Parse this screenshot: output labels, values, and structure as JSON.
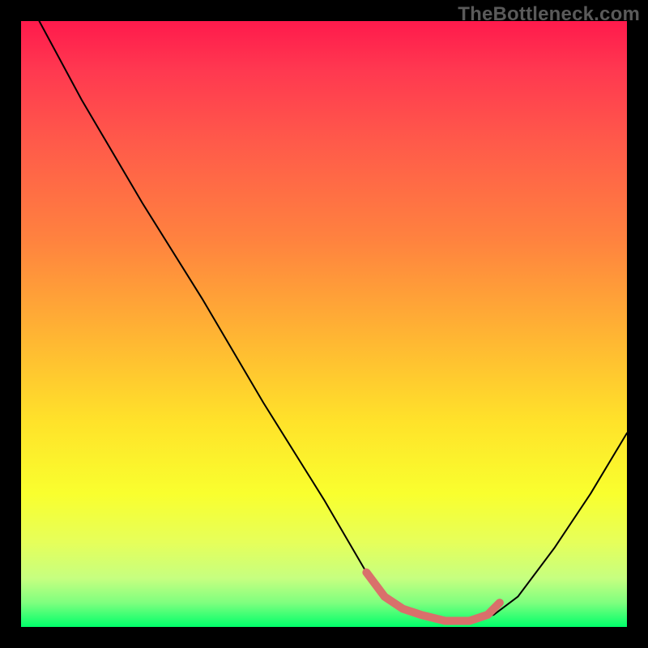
{
  "watermark": "TheBottleneck.com",
  "chart_data": {
    "type": "line",
    "title": "",
    "xlabel": "",
    "ylabel": "",
    "xlim": [
      0,
      100
    ],
    "ylim": [
      0,
      100
    ],
    "grid": false,
    "legend": false,
    "series": [
      {
        "name": "bottleneck-curve",
        "color": "#000000",
        "width": 2,
        "x": [
          3,
          10,
          20,
          30,
          40,
          50,
          57,
          60,
          63,
          66,
          70,
          74,
          78,
          82,
          88,
          94,
          100
        ],
        "y": [
          100,
          87,
          70,
          54,
          37,
          21,
          9,
          5,
          3,
          2,
          1,
          1,
          2,
          5,
          13,
          22,
          32
        ]
      },
      {
        "name": "optimal-range-marker",
        "color": "#d9706b",
        "width": 10,
        "x": [
          57,
          60,
          63,
          66,
          70,
          74,
          77,
          79
        ],
        "y": [
          9,
          5,
          3,
          2,
          1,
          1,
          2,
          4
        ]
      }
    ],
    "annotations": []
  }
}
